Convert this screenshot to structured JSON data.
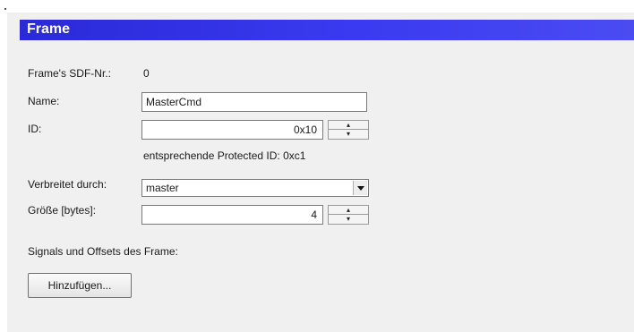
{
  "frame": {
    "title": "Frame",
    "sdf_label": "Frame's SDF-Nr.:",
    "sdf_value": "0",
    "name_label": "Name:",
    "name_value": "MasterCmd",
    "id_label": "ID:",
    "id_value": "0x10",
    "protected_id_text": "entsprechende Protected ID: 0xc1",
    "distributed_label": "Verbreitet durch:",
    "distributed_value": "master",
    "size_label": "Größe [bytes]:",
    "size_value": "4",
    "signals_label": "Signals und Offsets des Frame:",
    "add_button_label": "Hinzufügen..."
  },
  "icons": {
    "spinner_up": "spin-up-arrow",
    "spinner_down": "spin-down-arrow",
    "dropdown": "chevron-down-icon"
  },
  "colors": {
    "title_bar": "#2a2ad8",
    "panel_bg": "#f0f0f0"
  }
}
